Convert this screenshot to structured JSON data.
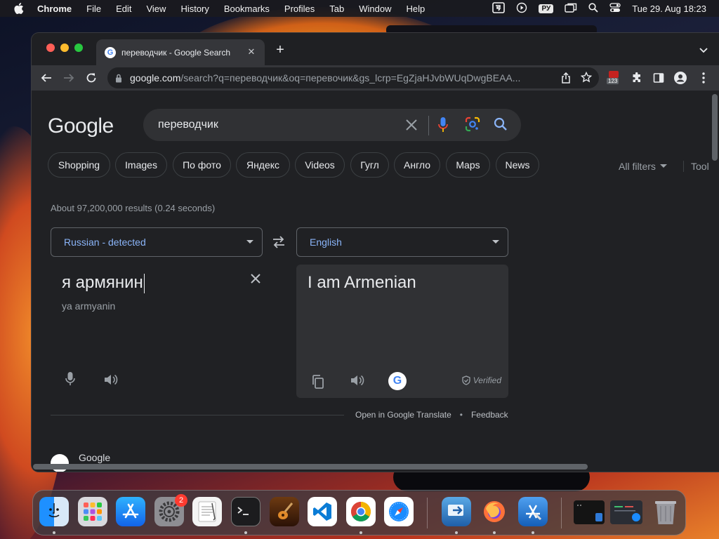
{
  "menubar": {
    "app_name": "Chrome",
    "items": [
      "File",
      "Edit",
      "View",
      "History",
      "Bookmarks",
      "Profiles",
      "Tab",
      "Window",
      "Help"
    ],
    "keyboard_layout": "РУ",
    "clock": "Tue 29. Aug  18:23"
  },
  "browser": {
    "tab_title": "переводчик - Google Search",
    "url_host": "google.com",
    "url_rest": "/search?q=переводчик&oq=перевочик&gs_lcrp=EgZjaHJvbWUqDwgBEAA...",
    "extension_badge": "123"
  },
  "search": {
    "logo": "Google",
    "query": "переводчик",
    "chips": [
      "Shopping",
      "Images",
      "По фото",
      "Яндекс",
      "Videos",
      "Гугл",
      "Англо",
      "Maps",
      "News"
    ],
    "all_filters": "All filters",
    "tools": "Tool",
    "stats": "About 97,200,000 results (0.24 seconds)"
  },
  "translate": {
    "source_lang": "Russian - detected",
    "target_lang": "English",
    "source_text": "я армянин",
    "transliteration": "ya armyanin",
    "translated_text": "I am Armenian",
    "verified": "Verified",
    "open_link": "Open in Google Translate",
    "feedback": "Feedback"
  },
  "result": {
    "site_name": "Google"
  },
  "dock": {
    "apps": [
      "Finder",
      "Launchpad",
      "App Store",
      "System Settings",
      "TextEdit",
      "Terminal",
      "GarageBand",
      "Visual Studio Code",
      "Google Chrome",
      "Safari",
      "Migration Assistant",
      "Firefox",
      "Xcode"
    ],
    "settings_badge": "2"
  }
}
